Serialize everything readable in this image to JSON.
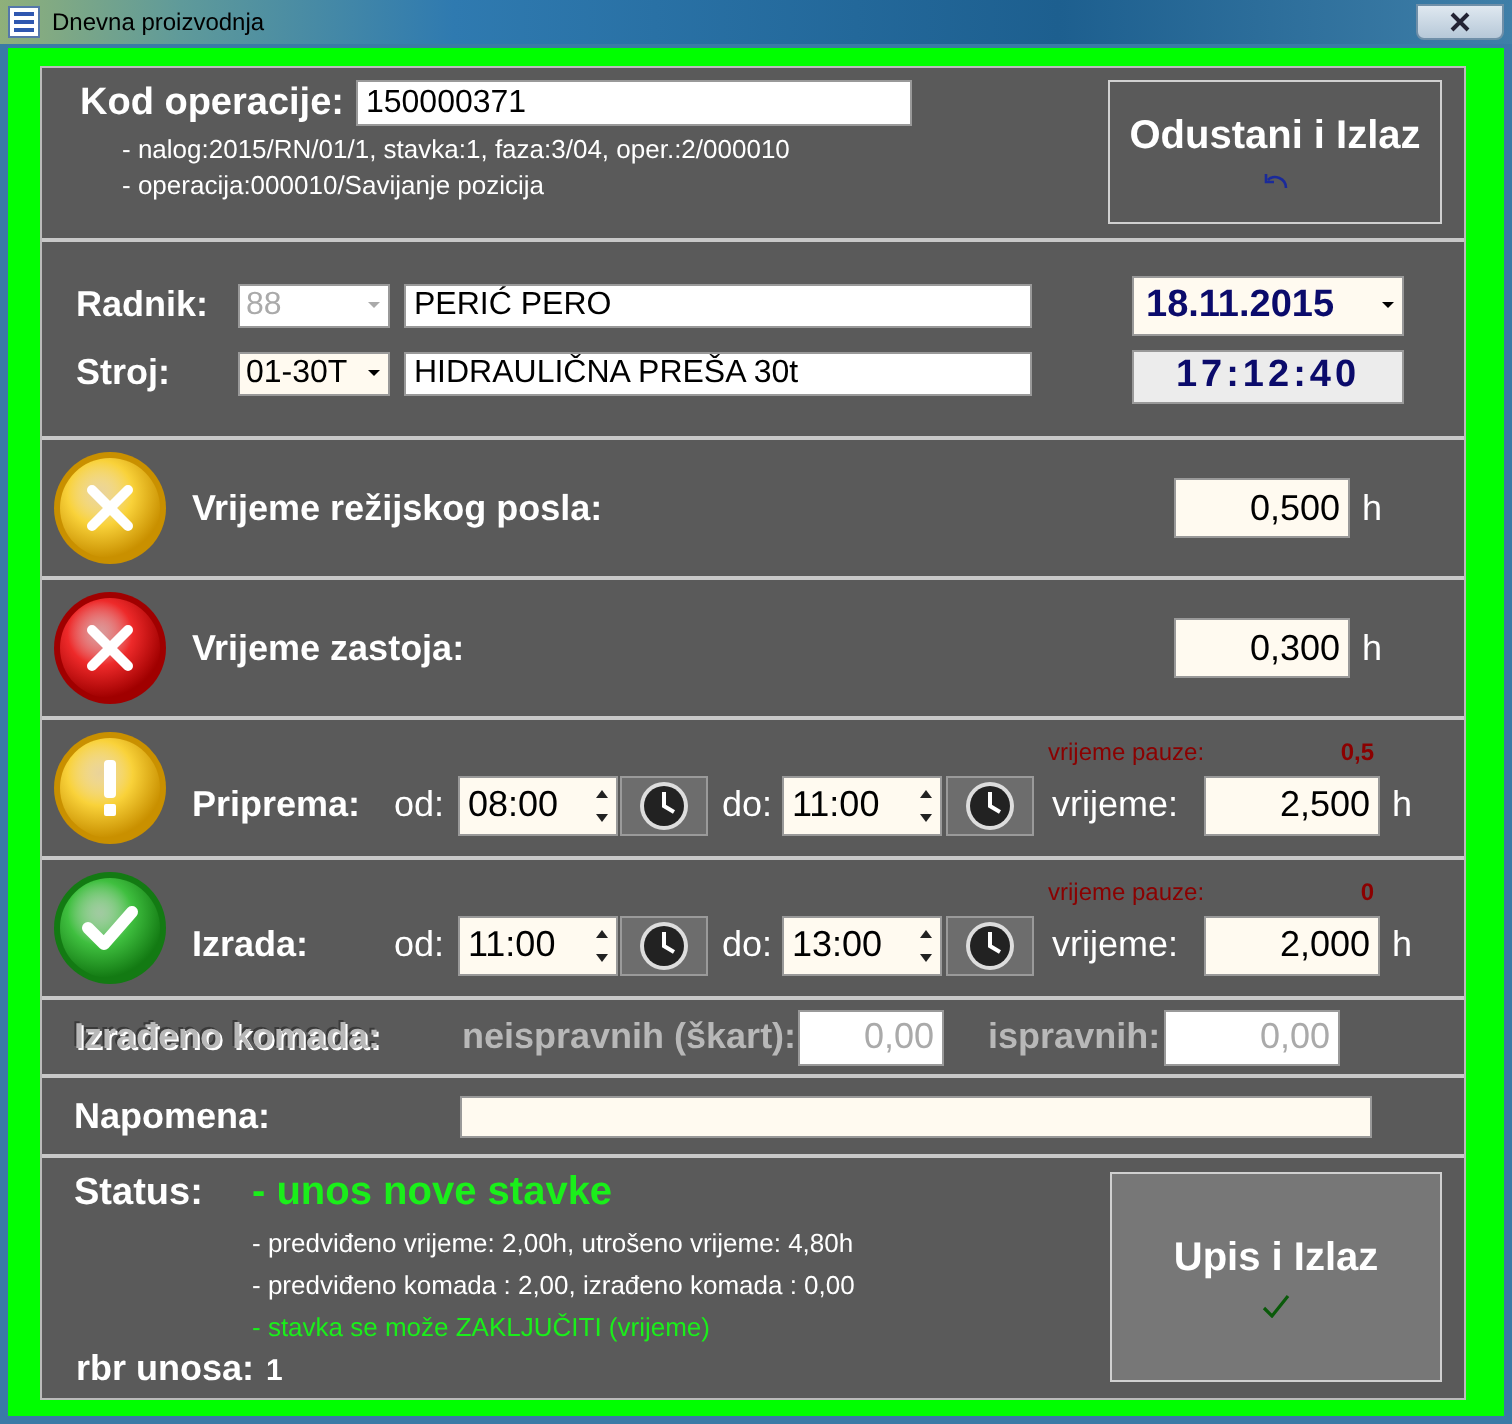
{
  "window": {
    "title": "Dnevna proizvodnja"
  },
  "operation": {
    "label": "Kod operacije:",
    "code": "150000371",
    "details": [
      "- nalog:2015/RN/01/1, stavka:1, faza:3/04, oper.:2/000010",
      "- operacija:000010/Savijanje pozicija"
    ]
  },
  "cancel_button": {
    "label": "Odustani i Izlaz"
  },
  "worker": {
    "label": "Radnik:",
    "id": "88",
    "id_disabled": true,
    "name": "PERIĆ PERO"
  },
  "machine": {
    "label": "Stroj:",
    "id": "01-30T",
    "id_disabled": false,
    "name": "HIDRAULIČNA PREŠA 30t"
  },
  "date": "18.11.2015",
  "clock": "17:12:40",
  "time_rows": [
    {
      "kind": "simple",
      "label": "Vrijeme režijskog posla:",
      "value": "0,500",
      "unit": "h"
    },
    {
      "kind": "simple",
      "label": "Vrijeme zastoja:",
      "value": "0,300",
      "unit": "h"
    },
    {
      "kind": "range",
      "label": "Priprema:",
      "from_label": "od:",
      "from": "08:00",
      "to_label": "do:",
      "to": "11:00",
      "pause_label": "vrijeme pauze:",
      "pause": "0,5",
      "time_label": "vrijeme:",
      "value": "2,500",
      "unit": "h"
    },
    {
      "kind": "range",
      "label": "Izrada:",
      "from_label": "od:",
      "from": "11:00",
      "to_label": "do:",
      "to": "13:00",
      "pause_label": "vrijeme pauze:",
      "pause": "0",
      "time_label": "vrijeme:",
      "value": "2,000",
      "unit": "h"
    }
  ],
  "pieces": {
    "label": "Izrađeno komada:",
    "disabled": true,
    "defect_label": "neispravnih (škart):",
    "defect": "0,00",
    "good_label": "ispravnih:",
    "good": "0,00"
  },
  "note": {
    "label": "Napomena:"
  },
  "status": {
    "label": "Status:",
    "value": "- unos nove stavke",
    "lines": [
      {
        "text": "- predviđeno vrijeme: 2,00h,  utrošeno vrijeme: 4,80h",
        "highlight": false
      },
      {
        "text": "- predviđeno komada : 2,00,  izrađeno komada : 0,00",
        "highlight": false
      },
      {
        "text": "- stavka se može ZAKLJUČITI (vrijeme)",
        "highlight": true
      }
    ],
    "entry_label": "rbr unosa:",
    "entry": "1"
  },
  "save_button": {
    "label": "Upis i Izlaz"
  }
}
